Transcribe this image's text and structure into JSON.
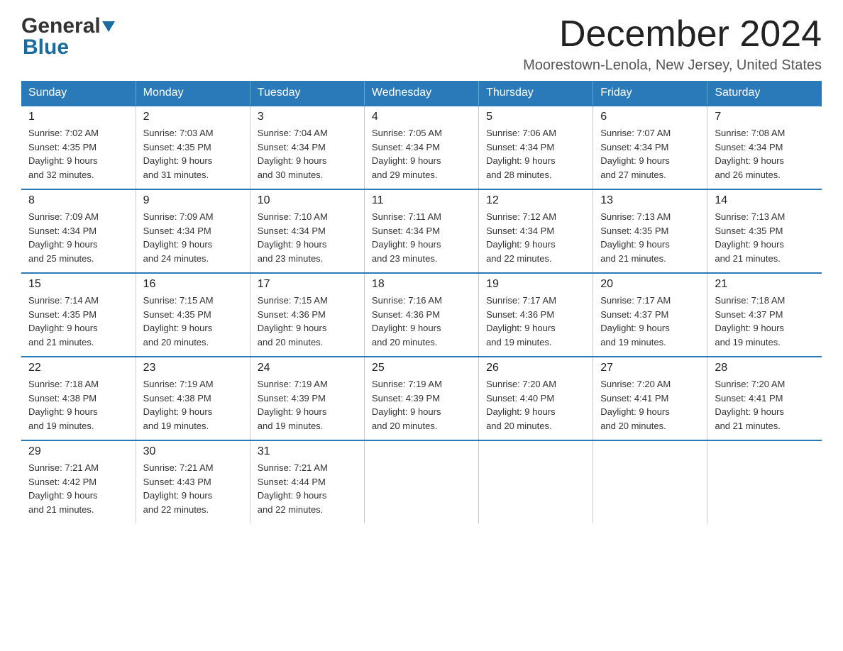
{
  "header": {
    "logo_general": "General",
    "logo_blue": "Blue",
    "month_title": "December 2024",
    "location": "Moorestown-Lenola, New Jersey, United States"
  },
  "weekdays": [
    "Sunday",
    "Monday",
    "Tuesday",
    "Wednesday",
    "Thursday",
    "Friday",
    "Saturday"
  ],
  "weeks": [
    [
      {
        "day": "1",
        "sunrise": "7:02 AM",
        "sunset": "4:35 PM",
        "daylight": "9 hours and 32 minutes."
      },
      {
        "day": "2",
        "sunrise": "7:03 AM",
        "sunset": "4:35 PM",
        "daylight": "9 hours and 31 minutes."
      },
      {
        "day": "3",
        "sunrise": "7:04 AM",
        "sunset": "4:34 PM",
        "daylight": "9 hours and 30 minutes."
      },
      {
        "day": "4",
        "sunrise": "7:05 AM",
        "sunset": "4:34 PM",
        "daylight": "9 hours and 29 minutes."
      },
      {
        "day": "5",
        "sunrise": "7:06 AM",
        "sunset": "4:34 PM",
        "daylight": "9 hours and 28 minutes."
      },
      {
        "day": "6",
        "sunrise": "7:07 AM",
        "sunset": "4:34 PM",
        "daylight": "9 hours and 27 minutes."
      },
      {
        "day": "7",
        "sunrise": "7:08 AM",
        "sunset": "4:34 PM",
        "daylight": "9 hours and 26 minutes."
      }
    ],
    [
      {
        "day": "8",
        "sunrise": "7:09 AM",
        "sunset": "4:34 PM",
        "daylight": "9 hours and 25 minutes."
      },
      {
        "day": "9",
        "sunrise": "7:09 AM",
        "sunset": "4:34 PM",
        "daylight": "9 hours and 24 minutes."
      },
      {
        "day": "10",
        "sunrise": "7:10 AM",
        "sunset": "4:34 PM",
        "daylight": "9 hours and 23 minutes."
      },
      {
        "day": "11",
        "sunrise": "7:11 AM",
        "sunset": "4:34 PM",
        "daylight": "9 hours and 23 minutes."
      },
      {
        "day": "12",
        "sunrise": "7:12 AM",
        "sunset": "4:34 PM",
        "daylight": "9 hours and 22 minutes."
      },
      {
        "day": "13",
        "sunrise": "7:13 AM",
        "sunset": "4:35 PM",
        "daylight": "9 hours and 21 minutes."
      },
      {
        "day": "14",
        "sunrise": "7:13 AM",
        "sunset": "4:35 PM",
        "daylight": "9 hours and 21 minutes."
      }
    ],
    [
      {
        "day": "15",
        "sunrise": "7:14 AM",
        "sunset": "4:35 PM",
        "daylight": "9 hours and 21 minutes."
      },
      {
        "day": "16",
        "sunrise": "7:15 AM",
        "sunset": "4:35 PM",
        "daylight": "9 hours and 20 minutes."
      },
      {
        "day": "17",
        "sunrise": "7:15 AM",
        "sunset": "4:36 PM",
        "daylight": "9 hours and 20 minutes."
      },
      {
        "day": "18",
        "sunrise": "7:16 AM",
        "sunset": "4:36 PM",
        "daylight": "9 hours and 20 minutes."
      },
      {
        "day": "19",
        "sunrise": "7:17 AM",
        "sunset": "4:36 PM",
        "daylight": "9 hours and 19 minutes."
      },
      {
        "day": "20",
        "sunrise": "7:17 AM",
        "sunset": "4:37 PM",
        "daylight": "9 hours and 19 minutes."
      },
      {
        "day": "21",
        "sunrise": "7:18 AM",
        "sunset": "4:37 PM",
        "daylight": "9 hours and 19 minutes."
      }
    ],
    [
      {
        "day": "22",
        "sunrise": "7:18 AM",
        "sunset": "4:38 PM",
        "daylight": "9 hours and 19 minutes."
      },
      {
        "day": "23",
        "sunrise": "7:19 AM",
        "sunset": "4:38 PM",
        "daylight": "9 hours and 19 minutes."
      },
      {
        "day": "24",
        "sunrise": "7:19 AM",
        "sunset": "4:39 PM",
        "daylight": "9 hours and 19 minutes."
      },
      {
        "day": "25",
        "sunrise": "7:19 AM",
        "sunset": "4:39 PM",
        "daylight": "9 hours and 20 minutes."
      },
      {
        "day": "26",
        "sunrise": "7:20 AM",
        "sunset": "4:40 PM",
        "daylight": "9 hours and 20 minutes."
      },
      {
        "day": "27",
        "sunrise": "7:20 AM",
        "sunset": "4:41 PM",
        "daylight": "9 hours and 20 minutes."
      },
      {
        "day": "28",
        "sunrise": "7:20 AM",
        "sunset": "4:41 PM",
        "daylight": "9 hours and 21 minutes."
      }
    ],
    [
      {
        "day": "29",
        "sunrise": "7:21 AM",
        "sunset": "4:42 PM",
        "daylight": "9 hours and 21 minutes."
      },
      {
        "day": "30",
        "sunrise": "7:21 AM",
        "sunset": "4:43 PM",
        "daylight": "9 hours and 22 minutes."
      },
      {
        "day": "31",
        "sunrise": "7:21 AM",
        "sunset": "4:44 PM",
        "daylight": "9 hours and 22 minutes."
      },
      null,
      null,
      null,
      null
    ]
  ],
  "labels": {
    "sunrise_prefix": "Sunrise: ",
    "sunset_prefix": "Sunset: ",
    "daylight_prefix": "Daylight: "
  }
}
